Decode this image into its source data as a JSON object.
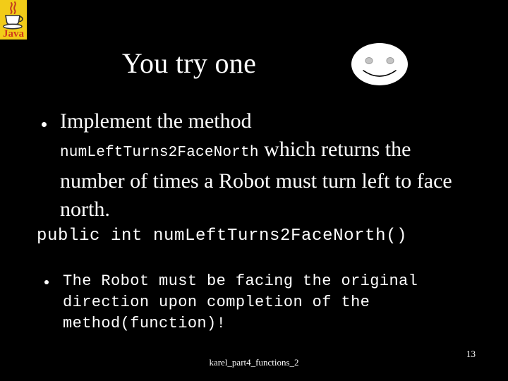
{
  "slide": {
    "background_color": "#000000",
    "text_color": "#ffffff",
    "title": "You try one",
    "page_number": "13",
    "footer_label": "karel_part4_functions_2"
  },
  "logo": {
    "name": "java-logo",
    "alt_text": "Java",
    "wordmark": "Java",
    "background_color": "#f2cc18",
    "wordmark_color": "#d03a1c",
    "cup_color": "#3b3b3b"
  },
  "smiley": {
    "name": "smiley-face",
    "face_color": "#ffffff",
    "eye_color": "#c4c4c4",
    "mouth_color": "#000000"
  },
  "bullets": [
    {
      "id": "bullet-implement-method",
      "lead": "Implement the method ",
      "code_span": "numLeftTurns2FaceNorth",
      "tail": " which returns the number of times a Robot must turn left to face north."
    },
    {
      "id": "bullet-facing-original-direction",
      "text": "The Robot must be facing the original\ndirection upon completion of the\nmethod(function)!"
    }
  ],
  "code": {
    "signature": "public int numLeftTurns2FaceNorth()"
  }
}
